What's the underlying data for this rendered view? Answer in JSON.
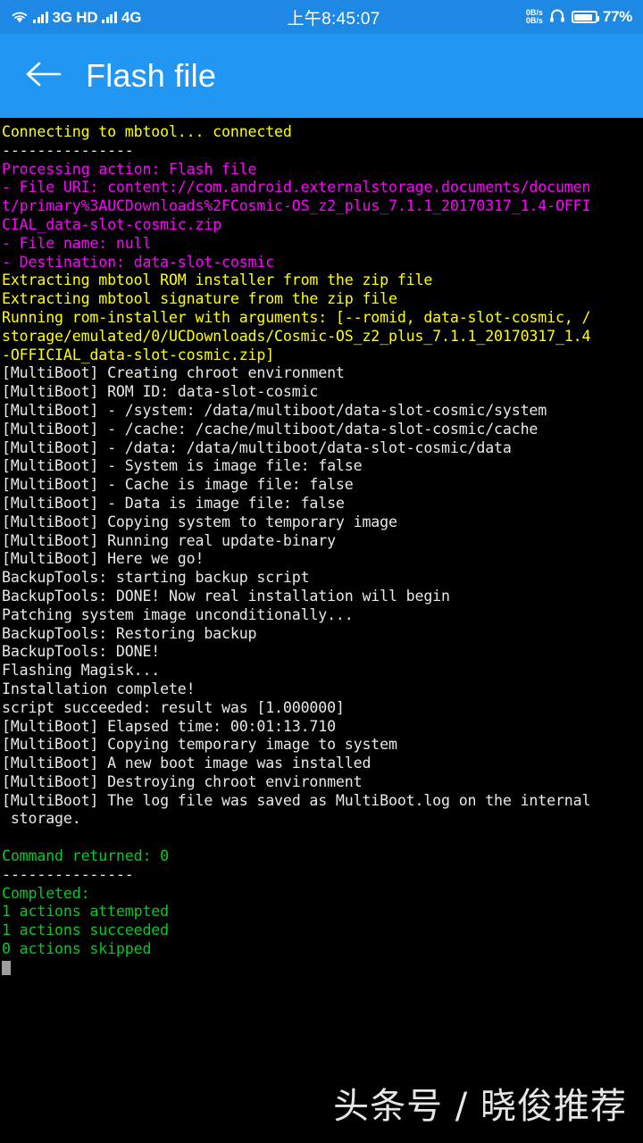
{
  "statusbar": {
    "icons": [
      "wifi-icon",
      "signal-bars-icon",
      "signal-bars-icon",
      "headphone-icon",
      "battery-icon"
    ],
    "network_1": "3G HD",
    "network_2": "4G",
    "time": "上午8:45:07",
    "netspeed_up": "0B/s",
    "netspeed_down": "0B/s",
    "battery_percent": "77%",
    "battery_level": 77,
    "background_color": "#1e88e5"
  },
  "appbar": {
    "back_label": "back-arrow",
    "title": "Flash file",
    "background_color": "#2196f3"
  },
  "terminal": {
    "background_color": "#000000",
    "colors": {
      "yellow": "#ffff00",
      "magenta": "#ff00ff",
      "white": "#e8e8e8",
      "green": "#00cc22",
      "cursor": "#9e9e9e"
    },
    "lines": [
      {
        "text": "Connecting to mbtool... connected",
        "color": "yellow"
      },
      {
        "text": "---------------",
        "color": "white"
      },
      {
        "text": "Processing action: Flash file",
        "color": "magenta"
      },
      {
        "text": "- File URI: content://com.android.externalstorage.documents/documen",
        "color": "magenta"
      },
      {
        "text": "t/primary%3AUCDownloads%2FCosmic-OS_z2_plus_7.1.1_20170317_1.4-OFFI",
        "color": "magenta"
      },
      {
        "text": "CIAL_data-slot-cosmic.zip",
        "color": "magenta"
      },
      {
        "text": "- File name: null",
        "color": "magenta"
      },
      {
        "text": "- Destination: data-slot-cosmic",
        "color": "magenta"
      },
      {
        "text": "Extracting mbtool ROM installer from the zip file",
        "color": "yellow"
      },
      {
        "text": "Extracting mbtool signature from the zip file",
        "color": "yellow"
      },
      {
        "text": "Running rom-installer with arguments: [--romid, data-slot-cosmic, /",
        "color": "yellow"
      },
      {
        "text": "storage/emulated/0/UCDownloads/Cosmic-OS_z2_plus_7.1.1_20170317_1.4",
        "color": "yellow"
      },
      {
        "text": "-OFFICIAL_data-slot-cosmic.zip]",
        "color": "yellow"
      },
      {
        "text": "[MultiBoot] Creating chroot environment",
        "color": "white"
      },
      {
        "text": "[MultiBoot] ROM ID: data-slot-cosmic",
        "color": "white"
      },
      {
        "text": "[MultiBoot] - /system: /data/multiboot/data-slot-cosmic/system",
        "color": "white"
      },
      {
        "text": "[MultiBoot] - /cache: /cache/multiboot/data-slot-cosmic/cache",
        "color": "white"
      },
      {
        "text": "[MultiBoot] - /data: /data/multiboot/data-slot-cosmic/data",
        "color": "white"
      },
      {
        "text": "[MultiBoot] - System is image file: false",
        "color": "white"
      },
      {
        "text": "[MultiBoot] - Cache is image file: false",
        "color": "white"
      },
      {
        "text": "[MultiBoot] - Data is image file: false",
        "color": "white"
      },
      {
        "text": "[MultiBoot] Copying system to temporary image",
        "color": "white"
      },
      {
        "text": "[MultiBoot] Running real update-binary",
        "color": "white"
      },
      {
        "text": "[MultiBoot] Here we go!",
        "color": "white"
      },
      {
        "text": "BackupTools: starting backup script",
        "color": "white"
      },
      {
        "text": "BackupTools: DONE! Now real installation will begin",
        "color": "white"
      },
      {
        "text": "Patching system image unconditionally...",
        "color": "white"
      },
      {
        "text": "BackupTools: Restoring backup",
        "color": "white"
      },
      {
        "text": "BackupTools: DONE!",
        "color": "white"
      },
      {
        "text": "Flashing Magisk...",
        "color": "white"
      },
      {
        "text": "Installation complete!",
        "color": "white"
      },
      {
        "text": "script succeeded: result was [1.000000]",
        "color": "white"
      },
      {
        "text": "[MultiBoot] Elapsed time: 00:01:13.710",
        "color": "white"
      },
      {
        "text": "[MultiBoot] Copying temporary image to system",
        "color": "white"
      },
      {
        "text": "[MultiBoot] A new boot image was installed",
        "color": "white"
      },
      {
        "text": "[MultiBoot] Destroying chroot environment",
        "color": "white"
      },
      {
        "text": "[MultiBoot] The log file was saved as MultiBoot.log on the internal",
        "color": "white"
      },
      {
        "text": " storage.",
        "color": "white"
      },
      {
        "text": "",
        "color": "white"
      },
      {
        "text": "Command returned: 0",
        "color": "green"
      },
      {
        "text": "---------------",
        "color": "white"
      },
      {
        "text": "Completed:",
        "color": "green"
      },
      {
        "text": "1 actions attempted",
        "color": "green"
      },
      {
        "text": "1 actions succeeded",
        "color": "green"
      },
      {
        "text": "0 actions skipped",
        "color": "green"
      }
    ],
    "cursor_visible": true
  },
  "watermark": {
    "text": "头条号 / 晓俊推荐"
  }
}
